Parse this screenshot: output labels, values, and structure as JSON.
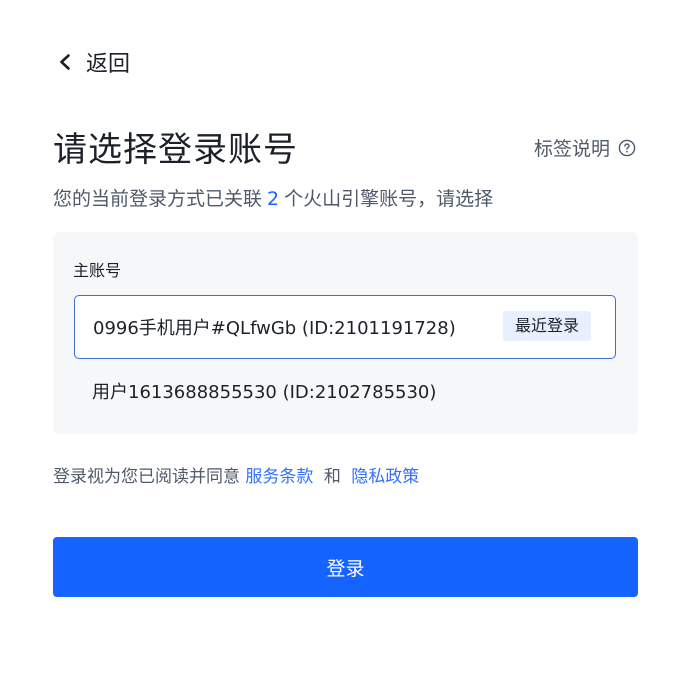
{
  "header": {
    "back_label": "返回"
  },
  "main": {
    "title": "请选择登录账号",
    "tag_help_label": "标签说明",
    "description_prefix": "您的当前登录方式已关联",
    "linked_count": "2",
    "description_suffix": "个火山引擎账号，请选择"
  },
  "panel": {
    "title": "主账号",
    "accounts": [
      {
        "name": "0996手机用户#QLfwGb (ID:2101191728)",
        "badge": "最近登录",
        "selected": true
      },
      {
        "name": "用户1613688855530 (ID:2102785530)",
        "selected": false
      }
    ]
  },
  "agreement": {
    "prefix": "登录视为您已阅读并同意",
    "terms_link": "服务条款",
    "and": "和",
    "privacy_link": "隐私政策"
  },
  "actions": {
    "login_label": "登录"
  },
  "colors": {
    "primary": "#1664ff",
    "link": "#3370ff",
    "panel_bg": "#f6f7f9",
    "badge_bg": "#e8f0ff",
    "selected_border": "#3b6fd6"
  },
  "icons": {
    "back": "chevron-left-icon",
    "help": "question-circle-icon"
  }
}
